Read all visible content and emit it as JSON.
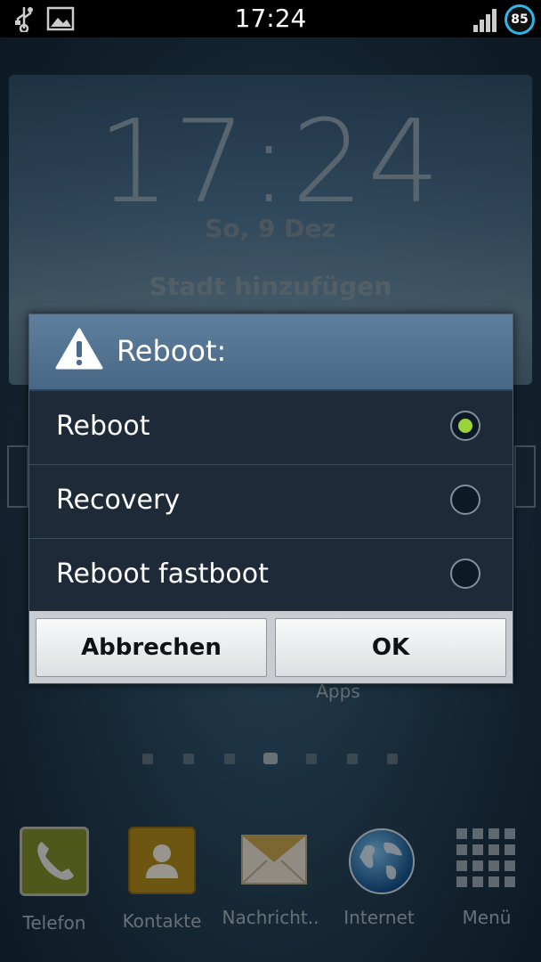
{
  "status_bar": {
    "time": "17:24",
    "battery_level": "85",
    "icons": [
      "usb-icon",
      "image-icon",
      "signal-icon",
      "battery-icon"
    ]
  },
  "widget": {
    "clock": "17:24",
    "date": "So, 9 Dez",
    "city": "Stadt hinzufügen"
  },
  "home": {
    "apps_label": "Apps",
    "page_count": 7,
    "active_page": 4
  },
  "dock": {
    "items": [
      {
        "label": "Telefon",
        "icon": "phone-icon"
      },
      {
        "label": "Kontakte",
        "icon": "contacts-icon"
      },
      {
        "label": "Nachricht..",
        "icon": "message-icon"
      },
      {
        "label": "Internet",
        "icon": "globe-icon"
      },
      {
        "label": "Menü",
        "icon": "apps-grid-icon"
      }
    ]
  },
  "dialog": {
    "title": "Reboot:",
    "icon": "warning-icon",
    "options": [
      {
        "label": "Reboot",
        "selected": true
      },
      {
        "label": "Recovery",
        "selected": false
      },
      {
        "label": "Reboot fastboot",
        "selected": false
      }
    ],
    "cancel_label": "Abbrechen",
    "ok_label": "OK"
  },
  "colors": {
    "radio_selected": "#9bd43a",
    "battery_ring": "#2fb6e8",
    "dialog_title": "#547493"
  }
}
